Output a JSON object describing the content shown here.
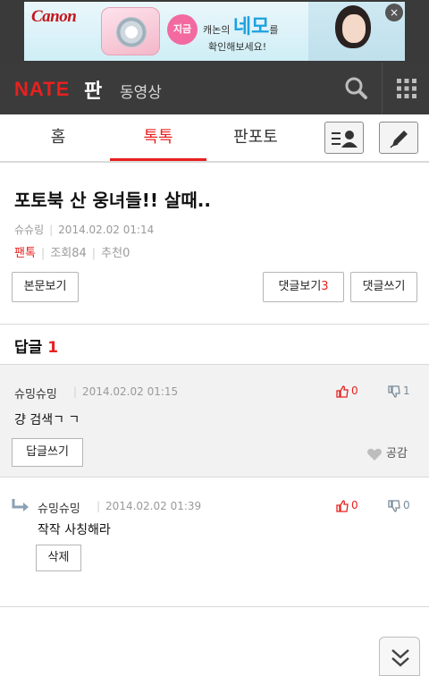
{
  "ad": {
    "brand": "Canon",
    "badge": "지금",
    "line1_prefix": "캐논의",
    "line1_highlight": "네모",
    "line1_suffix": "를",
    "line2": "확인해보세요!"
  },
  "header": {
    "logo": "NATE",
    "service": "판",
    "video_link": "동영상",
    "search_icon": "search-icon",
    "menu_icon": "grid-menu-icon"
  },
  "tabs": [
    {
      "label": "홈",
      "active": false
    },
    {
      "label": "톡톡",
      "active": true
    },
    {
      "label": "판포토",
      "active": false
    }
  ],
  "article": {
    "title": "포토북 산 웅녀들!! 살때..",
    "author": "슈슈링",
    "date": "2014.02.02 01:14",
    "category": "팬톡",
    "views_label": "조회",
    "views": "84",
    "recommend_label": "추천",
    "recommend": "0"
  },
  "buttons": {
    "view_body": "본문보기",
    "view_comments": "댓글보기",
    "comment_count": "3",
    "write_comment": "댓글쓰기"
  },
  "replies": {
    "label": "답글",
    "count": "1"
  },
  "comments": [
    {
      "author": "슈밍슈밍",
      "date": "2014.02.02 01:15",
      "body": "걍 검색ㄱ ㄱ",
      "up": "0",
      "down": "1",
      "reply_button": "답글쓰기",
      "like_label": "공감"
    },
    {
      "author": "슈밍슈밍",
      "date": "2014.02.02 01:39",
      "body": "작작 사칭해라",
      "up": "0",
      "down": "0",
      "delete_button": "삭제"
    }
  ],
  "colors": {
    "accent": "#e8201f",
    "header_bg": "#3b3b3b",
    "comment_bg": "#f2f2f2"
  }
}
